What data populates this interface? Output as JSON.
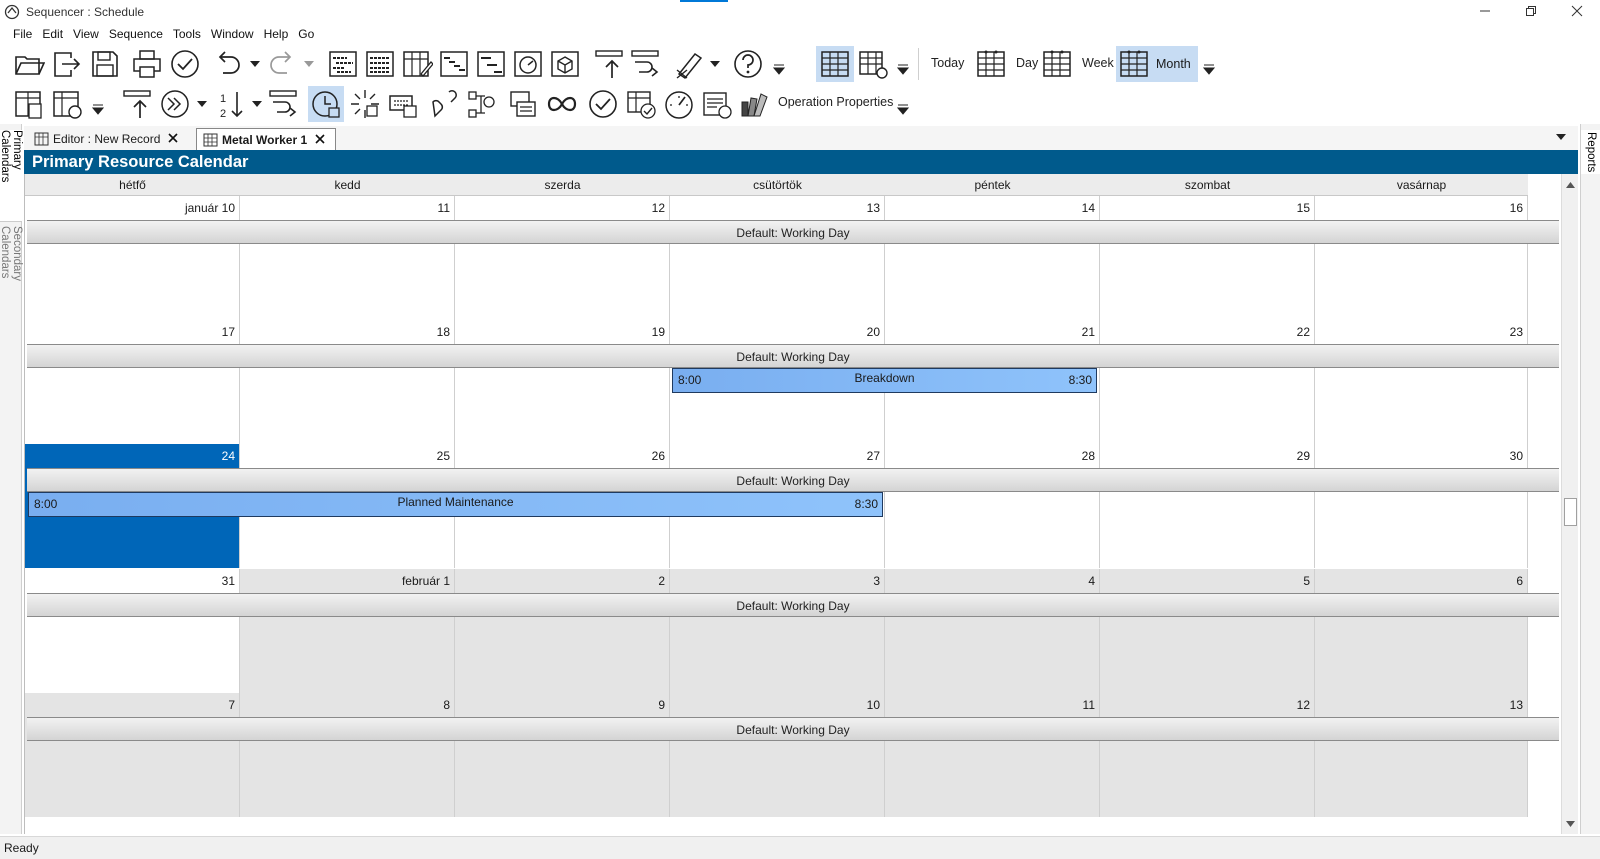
{
  "window": {
    "title": "Sequencer : Schedule"
  },
  "menu": [
    "File",
    "Edit",
    "View",
    "Sequence",
    "Tools",
    "Window",
    "Help",
    "Go"
  ],
  "toolbar": {
    "today_label": "Today",
    "day_label": "Day",
    "week_label": "Week",
    "month_label": "Month",
    "operation_properties_label": "Operation Properties"
  },
  "side_tabs": {
    "primary": "Primary Calendars",
    "secondary": "Secondary Calendars",
    "reports": "Reports"
  },
  "doc_tabs": [
    {
      "label": "Editor : New Record",
      "active": false
    },
    {
      "label": "Metal Worker 1",
      "active": true
    }
  ],
  "calendar": {
    "title": "Primary Resource Calendar",
    "day_names": [
      "hétfő",
      "kedd",
      "szerda",
      "csütörtök",
      "péntek",
      "szombat",
      "vasárnap"
    ],
    "weeks": [
      {
        "days": [
          "január 10",
          "11",
          "12",
          "13",
          "14",
          "15",
          "16"
        ],
        "label": "Default: Working Day"
      },
      {
        "days": [
          "17",
          "18",
          "19",
          "20",
          "21",
          "22",
          "23"
        ],
        "label": "Default: Working Day"
      },
      {
        "days": [
          "24",
          "25",
          "26",
          "27",
          "28",
          "29",
          "30"
        ],
        "label": "Default: Working Day"
      },
      {
        "days": [
          "31",
          "február 1",
          "2",
          "3",
          "4",
          "5",
          "6"
        ],
        "label": "Default: Working Day"
      },
      {
        "days": [
          "7",
          "8",
          "9",
          "10",
          "11",
          "12",
          "13"
        ],
        "label": "Default: Working Day"
      }
    ],
    "events": [
      {
        "name": "Breakdown",
        "start": "8:00",
        "end": "8:30"
      },
      {
        "name": "Planned Maintenance",
        "start": "8:00",
        "end": "8:30"
      }
    ]
  },
  "colors": {
    "header": "#005a8c",
    "today": "#0066b8",
    "event": "#7fb6f5",
    "other_month": "#e4e4e4"
  },
  "status": {
    "text": "Ready"
  }
}
